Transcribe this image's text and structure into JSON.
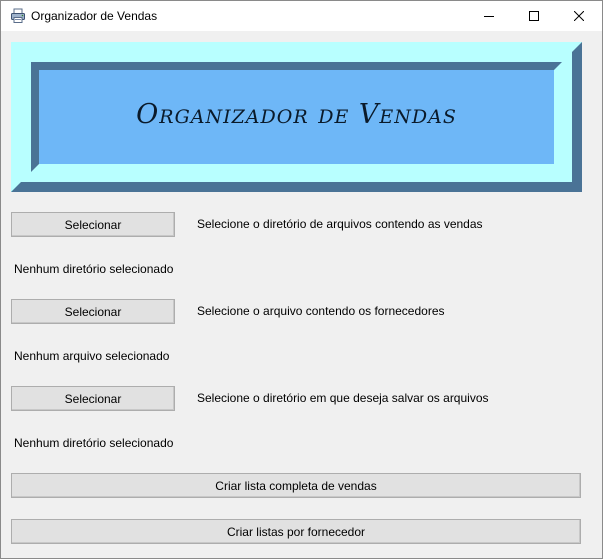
{
  "window": {
    "title": "Organizador de Vendas"
  },
  "banner": {
    "title": "Organizador de Vendas",
    "colors": {
      "fill": "#6eb7f7",
      "light": "#b8ffff",
      "dark": "#4a7396"
    }
  },
  "sections": [
    {
      "button_label": "Selecionar",
      "description": "Selecione o diretório de arquivos contendo as vendas",
      "status": "Nenhum diretório selecionado"
    },
    {
      "button_label": "Selecionar",
      "description": "Selecione o arquivo contendo os fornecedores",
      "status": "Nenhum arquivo selecionado"
    },
    {
      "button_label": "Selecionar",
      "description": "Selecione o diretório em que deseja salvar os arquivos",
      "status": "Nenhum diretório selecionado"
    }
  ],
  "actions": {
    "full_list_label": "Criar lista completa de vendas",
    "per_supplier_label": "Criar listas por fornecedor"
  },
  "icons": {
    "app": "printer-icon",
    "minimize": "minimize-icon",
    "maximize": "maximize-icon",
    "close": "close-icon"
  }
}
